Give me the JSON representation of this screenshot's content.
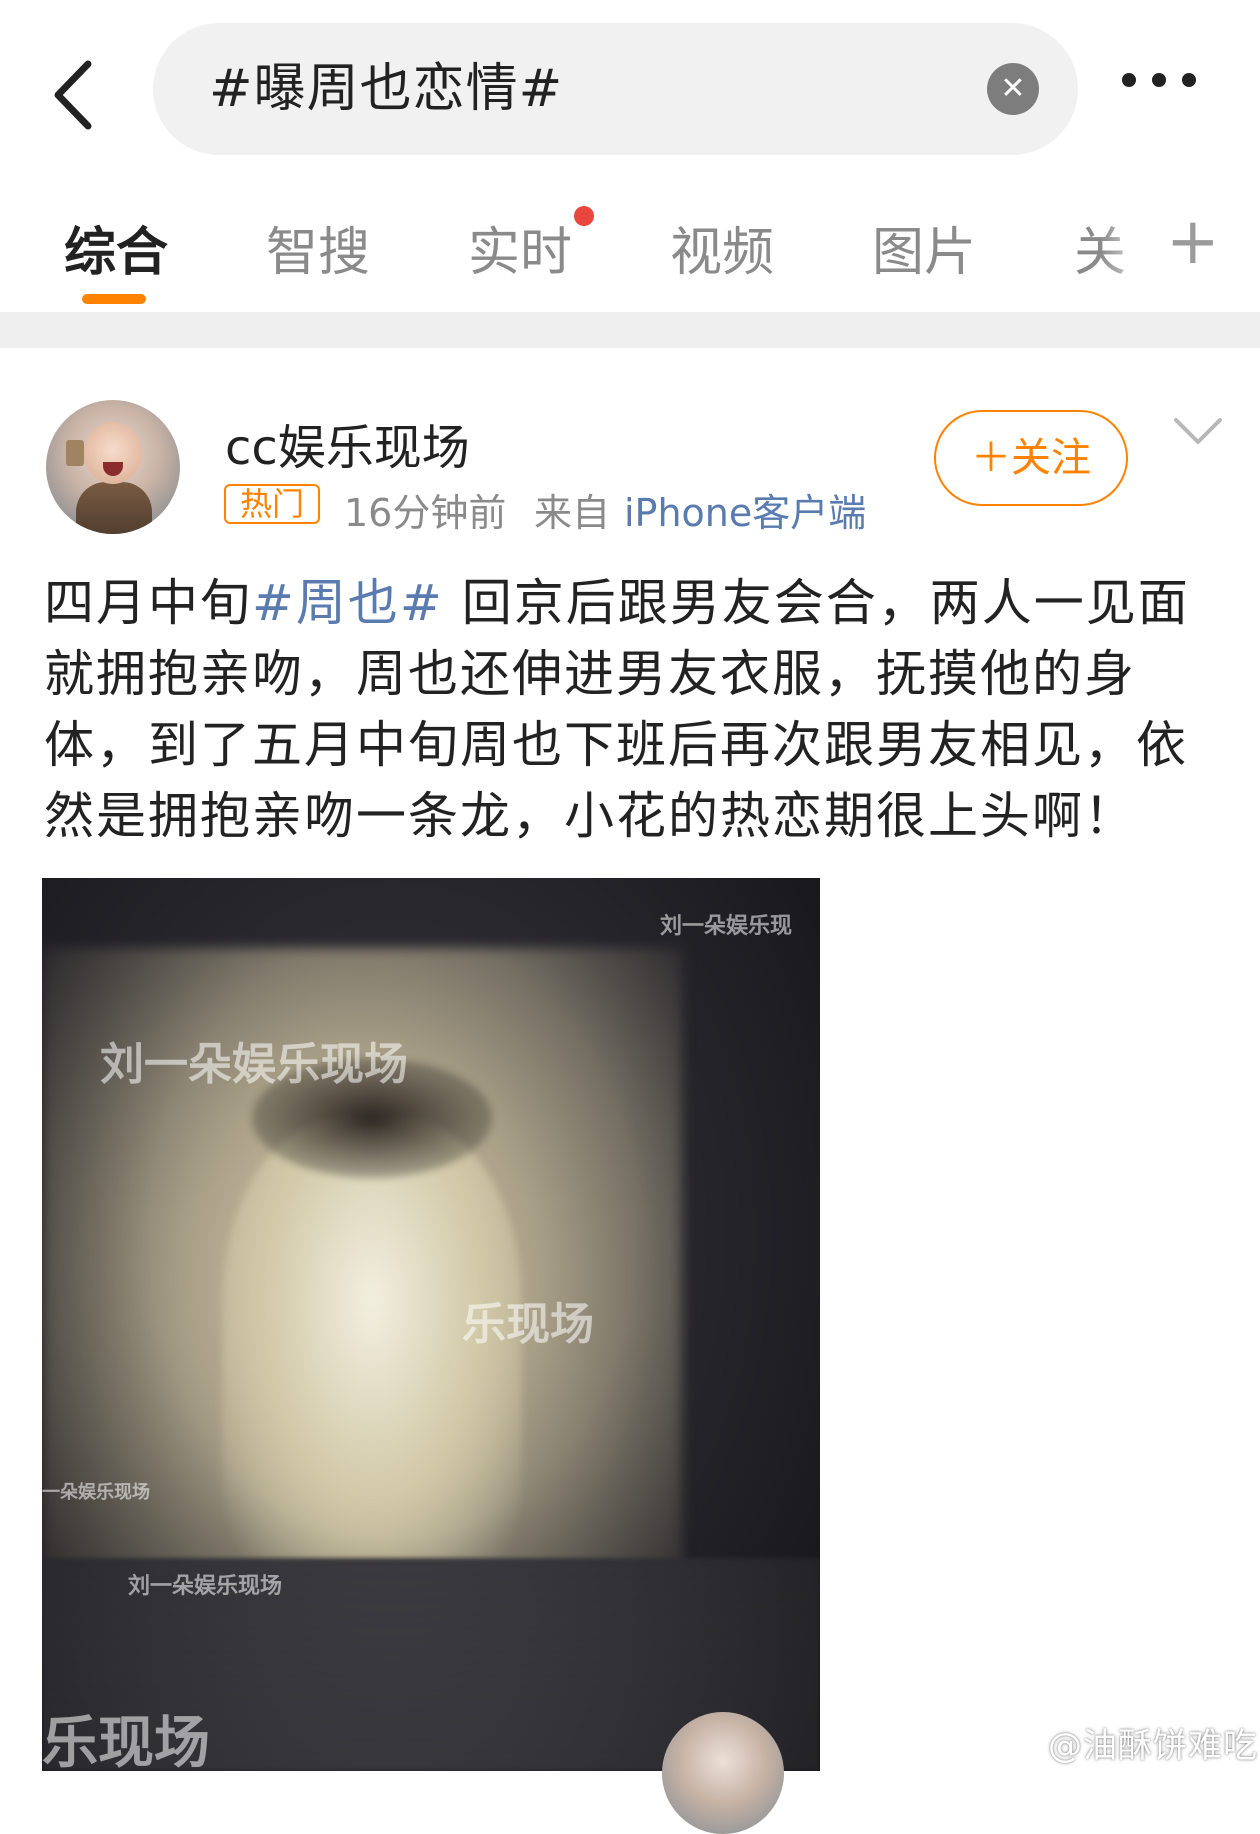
{
  "search": {
    "query": "#曝周也恋情#",
    "clear_glyph": "✕"
  },
  "tabs": [
    {
      "label": "综合",
      "active": true
    },
    {
      "label": "智搜",
      "active": false
    },
    {
      "label": "实时",
      "active": false,
      "has_red_dot": true
    },
    {
      "label": "视频",
      "active": false
    },
    {
      "label": "图片",
      "active": false
    },
    {
      "label": "关",
      "active": false
    }
  ],
  "tabs_add_glyph": "+",
  "post": {
    "username": "cc娱乐现场",
    "badge": "热门",
    "time": "16分钟前",
    "from_prefix": "来自",
    "device": "iPhone客户端",
    "follow_label": "＋关注",
    "text_before_tag": "四月中旬",
    "hashtag": "#周也#",
    "text_after_tag": " 回京后跟男友会合，两人一见面就拥抱亲吻，周也还伸进男友衣服，抚摸他的身体，到了五月中旬周也下班后再次跟男友相见，依然是拥抱亲吻一条龙，小花的热恋期很上头啊！",
    "image": {
      "watermarks": [
        "刘一朵娱乐现",
        "刘一朵娱乐现场",
        "乐现场",
        "一朵娱乐现场",
        "刘一朵娱乐现场",
        "乐现场"
      ]
    }
  },
  "site_watermark": "@油酥饼难吃",
  "colors": {
    "accent": "#ff8200",
    "link": "#5a7bb0",
    "red_dot": "#e8473d"
  }
}
